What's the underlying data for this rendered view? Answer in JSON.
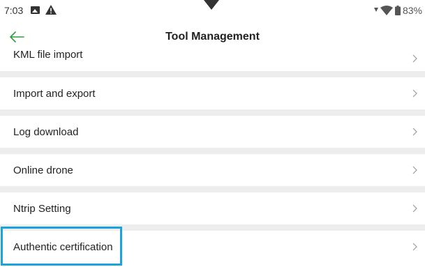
{
  "status_bar": {
    "time": "7:03",
    "battery": "83%",
    "icons": [
      "image-icon",
      "warning-icon",
      "signal-icon",
      "wifi-icon",
      "battery-icon"
    ]
  },
  "header": {
    "title": "Tool Management",
    "back_icon": "arrow-left-icon",
    "accent_color": "#2e9e3f"
  },
  "menu": {
    "items": [
      {
        "label": "KML file import",
        "icon": "chevron-right-icon"
      },
      {
        "label": "Import and export",
        "icon": "chevron-right-icon"
      },
      {
        "label": "Log download",
        "icon": "chevron-right-icon"
      },
      {
        "label": "Online drone",
        "icon": "chevron-right-icon"
      },
      {
        "label": "Ntrip Setting",
        "icon": "chevron-right-icon"
      },
      {
        "label": "Authentic certification",
        "icon": "chevron-right-icon"
      }
    ]
  },
  "highlight_color": "#1aa3de"
}
